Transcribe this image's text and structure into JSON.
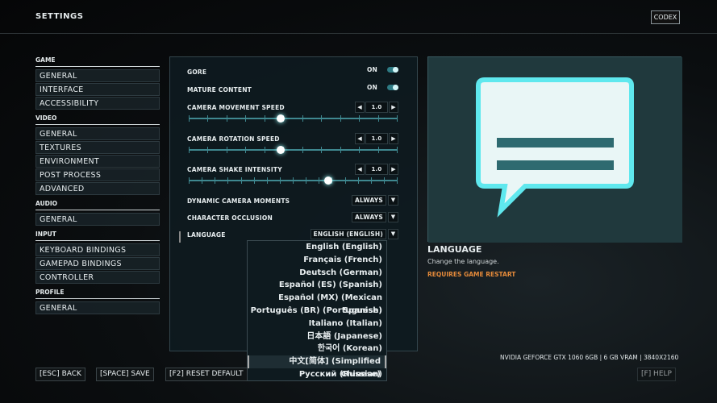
{
  "header": {
    "title": "SETTINGS",
    "codex": "CODEX"
  },
  "sidebar": [
    {
      "section": "GAME",
      "items": [
        "GENERAL",
        "INTERFACE",
        "ACCESSIBILITY"
      ]
    },
    {
      "section": "VIDEO",
      "items": [
        "GENERAL",
        "TEXTURES",
        "ENVIRONMENT",
        "POST PROCESS",
        "ADVANCED"
      ]
    },
    {
      "section": "AUDIO",
      "items": [
        "GENERAL"
      ]
    },
    {
      "section": "INPUT",
      "items": [
        "KEYBOARD BINDINGS",
        "GAMEPAD BINDINGS",
        "CONTROLLER"
      ]
    },
    {
      "section": "PROFILE",
      "items": [
        "GENERAL"
      ]
    }
  ],
  "settings": {
    "gore": {
      "label": "GORE",
      "value": "ON"
    },
    "mature": {
      "label": "MATURE CONTENT",
      "value": "ON"
    },
    "move": {
      "label": "CAMERA MOVEMENT SPEED",
      "value": "1.0",
      "fraction": 0.44
    },
    "rot": {
      "label": "CAMERA ROTATION SPEED",
      "value": "1.0",
      "fraction": 0.44
    },
    "shake": {
      "label": "CAMERA SHAKE INTENSITY",
      "value": "1.0",
      "fraction": 0.67
    },
    "dyn": {
      "label": "DYNAMIC CAMERA MOMENTS",
      "value": "ALWAYS"
    },
    "occ": {
      "label": "CHARACTER OCCLUSION",
      "value": "ALWAYS"
    },
    "lang": {
      "label": "LANGUAGE",
      "value": "ENGLISH (ENGLISH)"
    }
  },
  "language_options": [
    "English (English)",
    "Français (French)",
    "Deutsch (German)",
    "Español (ES) (Spanish)",
    "Español (MX) (Mexican Spanish)",
    "Português (BR) (Portuguese)",
    "Italiano (Italian)",
    "日本語 (Japanese)",
    "한국어 (Korean)",
    "中文[简体] (Simplified Chinese)",
    "Русский (Russian)"
  ],
  "language_selected_index": 9,
  "info": {
    "title": "LANGUAGE",
    "description": "Change the language.",
    "warning": "REQUIRES GAME RESTART",
    "warning_color": "#e58a3a"
  },
  "system": "NVIDIA GEFORCE GTX 1060 6GB | 6 GB VRAM | 3840X2160",
  "footer": {
    "back": "[ESC] BACK",
    "save": "[SPACE] SAVE",
    "reset": "[F2] RESET DEFAULT",
    "help": "[F] HELP"
  },
  "accent": "#3f8890"
}
